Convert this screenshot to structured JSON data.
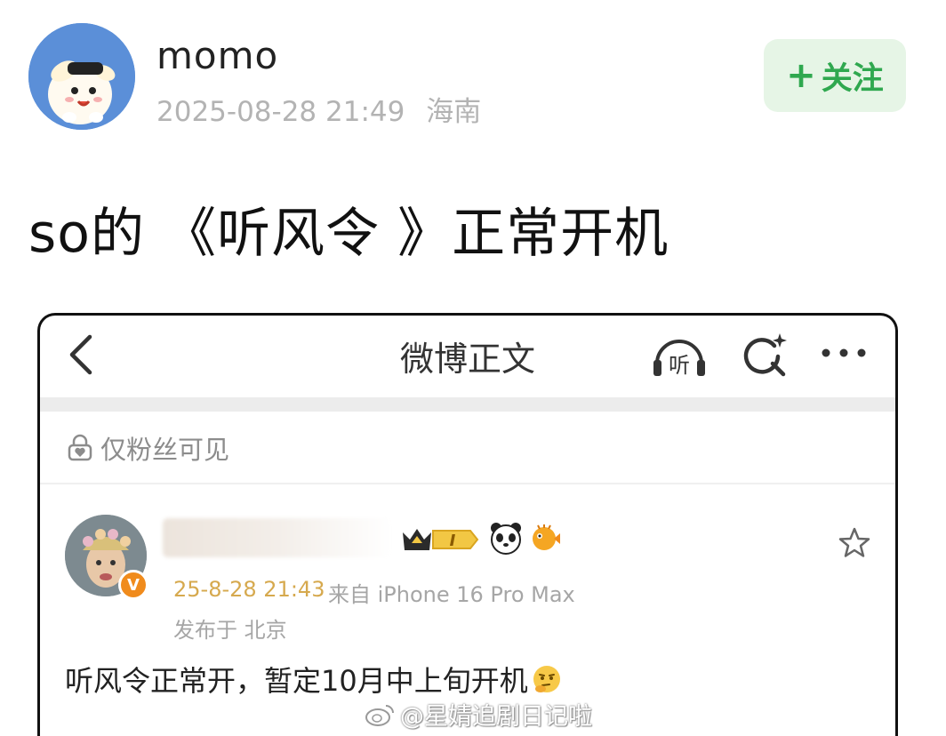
{
  "post": {
    "username": "momo",
    "timestamp": "2025-08-28 21:49",
    "location": "海南",
    "follow_label": "关注",
    "follow_plus": "+",
    "text": "so的 《听风令 》正常开机"
  },
  "screenshot": {
    "nav_title": "微博正文",
    "listen_icon_text": "听",
    "visibility_label": "仅粉丝可见",
    "inner_post": {
      "vip_level": "I",
      "verified_badge": "V",
      "time": "25-8-28 21:43",
      "source": "来自 iPhone 16 Pro Max",
      "location": "发布于 北京",
      "text": "听风令正常开，暂定10月中上旬开机"
    }
  },
  "watermark": {
    "text": "@星婧追剧日记啦"
  },
  "colors": {
    "follow_bg": "#e6f5e6",
    "follow_text": "#2fa84f",
    "inner_time": "#d6a94e",
    "verified_badge": "#f08b1c",
    "avatar_bg": "#5b8fd8"
  },
  "icons": [
    "back-arrow-icon",
    "listen-headphones-icon",
    "search-sparkle-icon",
    "more-dots-icon",
    "lock-heart-icon",
    "crown-vip-icon",
    "panda-icon",
    "pufferfish-icon",
    "star-icon",
    "thinking-emoji-icon",
    "weibo-logo-icon"
  ]
}
